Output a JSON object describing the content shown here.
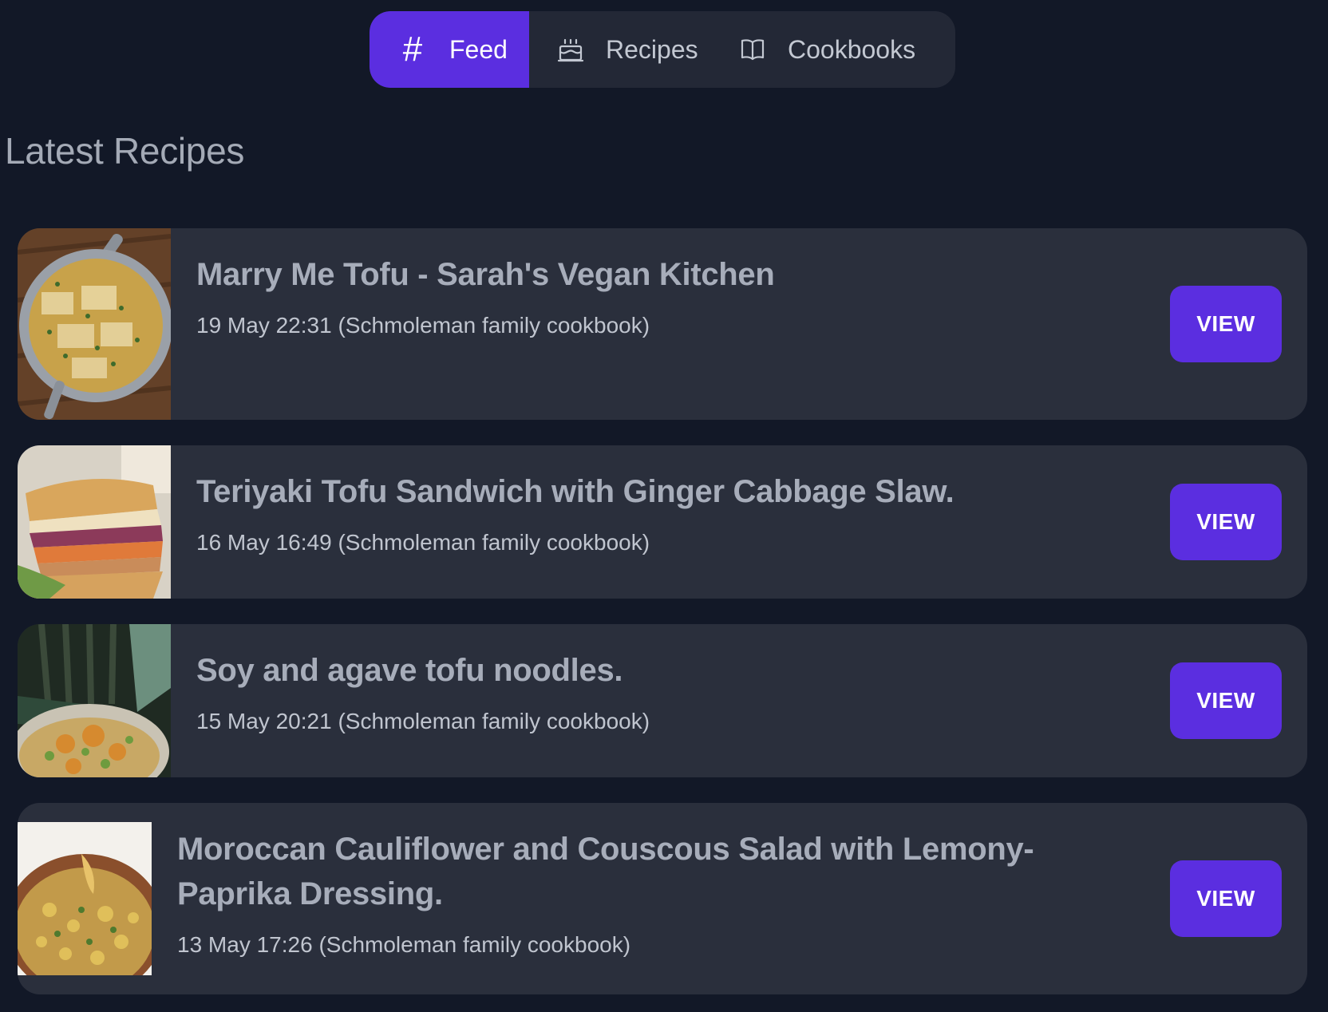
{
  "colors": {
    "background": "#121827",
    "card": "#2a2f3c",
    "accent": "#5b2ee0",
    "tabbar": "#232836"
  },
  "tabs": [
    {
      "label": "Feed",
      "icon": "hash-icon",
      "active": true
    },
    {
      "label": "Recipes",
      "icon": "cake-icon",
      "active": false
    },
    {
      "label": "Cookbooks",
      "icon": "book-open-icon",
      "active": false
    }
  ],
  "feed": {
    "title": "Latest Recipes",
    "recipes": [
      {
        "title": "Marry Me Tofu - Sarah's Vegan Kitchen",
        "meta": "19 May 22:31 (Schmoleman family cookbook)",
        "button": "VIEW"
      },
      {
        "title": "Teriyaki Tofu Sandwich with Ginger Cabbage Slaw.",
        "meta": "16 May 16:49 (Schmoleman family cookbook)",
        "button": "VIEW"
      },
      {
        "title": "Soy and agave tofu noodles.",
        "meta": "15 May 20:21 (Schmoleman family cookbook)",
        "button": "VIEW"
      },
      {
        "title": "Moroccan Cauliflower and Couscous Salad with Lemony-Paprika Dressing.",
        "meta": "13 May 17:26 (Schmoleman family cookbook)",
        "button": "VIEW"
      }
    ]
  }
}
